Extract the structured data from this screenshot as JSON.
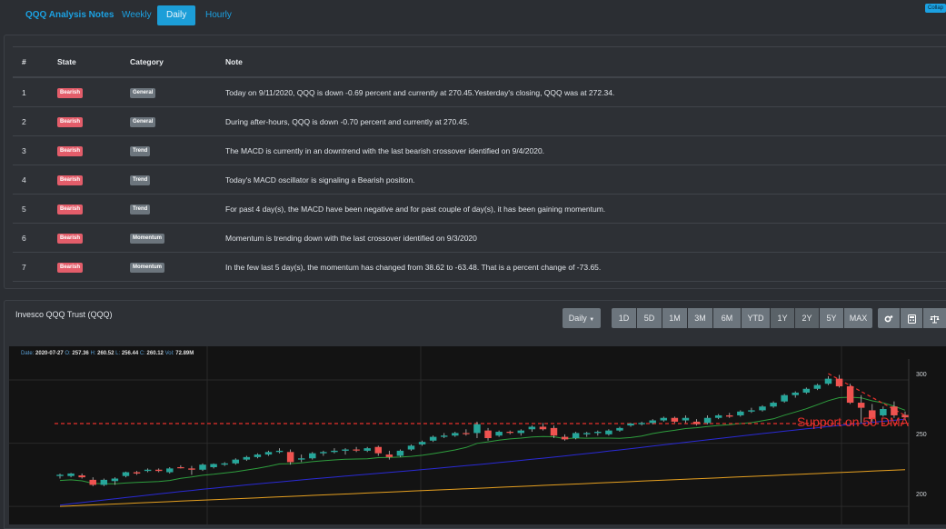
{
  "nav": {
    "brand": "QQQ Analysis Notes",
    "tabs": [
      "Weekly",
      "Daily",
      "Hourly"
    ],
    "collapse": "Collap"
  },
  "notes_table": {
    "headers": [
      "#",
      "State",
      "Category",
      "Note"
    ],
    "rows": [
      {
        "num": "1",
        "state": "Bearish",
        "category": "General",
        "note": "Today on 9/11/2020, QQQ is down -0.69 percent and currently at 270.45.Yesterday's closing, QQQ was at 272.34."
      },
      {
        "num": "2",
        "state": "Bearish",
        "category": "General",
        "note": "During after-hours, QQQ is down -0.70 percent and currently at 270.45."
      },
      {
        "num": "3",
        "state": "Bearish",
        "category": "Trend",
        "note": "The MACD is currently in an downtrend with the last bearish crossover identified on 9/4/2020."
      },
      {
        "num": "4",
        "state": "Bearish",
        "category": "Trend",
        "note": "Today's MACD oscillator is signaling a Bearish position."
      },
      {
        "num": "5",
        "state": "Bearish",
        "category": "Trend",
        "note": "For past 4 day(s), the MACD have been negative and for past couple of day(s), it has been gaining momentum."
      },
      {
        "num": "6",
        "state": "Bearish",
        "category": "Momentum",
        "note": "Momentum is trending down with the last crossover identified on 9/3/2020"
      },
      {
        "num": "7",
        "state": "Bearish",
        "category": "Momentum",
        "note": "In the few last 5 day(s), the momentum has changed from 38.62 to -63.48. That is a percent change of -73.65."
      }
    ]
  },
  "chart_panel": {
    "title": "Invesco QQQ Trust (QQQ)",
    "interval": "Daily",
    "ranges": [
      "1D",
      "5D",
      "1M",
      "3M",
      "6M",
      "YTD",
      "1Y",
      "2Y",
      "5Y",
      "MAX"
    ],
    "active_ranges": [
      "1Y",
      "2Y"
    ],
    "tool_icons": [
      "settings-icon",
      "calculator-icon",
      "scale-icon"
    ]
  },
  "readout": {
    "date_label": "Date:",
    "date": "2020-07-27",
    "o_label": "O:",
    "o": "257.36",
    "h_label": "H:",
    "h": "260.52",
    "l_label": "L:",
    "l": "256.44",
    "c_label": "C:",
    "c": "260.12",
    "vol_label": "Vol:",
    "vol": "72.89M"
  },
  "annotation": "Support on 50 DMA",
  "colors": {
    "accent": "#1ba1e2",
    "bearish": "#e35d6a",
    "up": "#26a69a",
    "down": "#ef5350",
    "ma_fast": "#2e9e3e",
    "ma_50": "#2a2ad6",
    "ma_200": "#e6a020",
    "support": "#e8302c"
  },
  "chart_data": {
    "type": "candlestick",
    "y_ticks": [
      200,
      250,
      300
    ],
    "ylim": [
      190,
      318
    ],
    "support_level": 265.5,
    "candles": [
      {
        "o": 224,
        "h": 226,
        "l": 222,
        "c": 225
      },
      {
        "o": 224,
        "h": 226.5,
        "l": 223,
        "c": 226
      },
      {
        "o": 224.5,
        "h": 226,
        "l": 222,
        "c": 223
      },
      {
        "o": 221,
        "h": 223,
        "l": 216,
        "c": 217
      },
      {
        "o": 217,
        "h": 222,
        "l": 216,
        "c": 221
      },
      {
        "o": 220,
        "h": 223,
        "l": 217,
        "c": 222
      },
      {
        "o": 224,
        "h": 227.5,
        "l": 223,
        "c": 227
      },
      {
        "o": 227,
        "h": 228,
        "l": 225,
        "c": 226
      },
      {
        "o": 228,
        "h": 230,
        "l": 227,
        "c": 229
      },
      {
        "o": 229,
        "h": 230,
        "l": 227,
        "c": 228
      },
      {
        "o": 227,
        "h": 231,
        "l": 226,
        "c": 230
      },
      {
        "o": 231,
        "h": 232.5,
        "l": 230,
        "c": 230.5
      },
      {
        "o": 230,
        "h": 232,
        "l": 225,
        "c": 229
      },
      {
        "o": 229,
        "h": 234,
        "l": 228,
        "c": 233
      },
      {
        "o": 231,
        "h": 234,
        "l": 230,
        "c": 233.5
      },
      {
        "o": 233,
        "h": 235,
        "l": 232,
        "c": 234
      },
      {
        "o": 234,
        "h": 238,
        "l": 233,
        "c": 237
      },
      {
        "o": 237,
        "h": 240,
        "l": 236,
        "c": 239
      },
      {
        "o": 239,
        "h": 242,
        "l": 238,
        "c": 241
      },
      {
        "o": 241,
        "h": 244,
        "l": 240,
        "c": 243
      },
      {
        "o": 243,
        "h": 246,
        "l": 242,
        "c": 244
      },
      {
        "o": 243,
        "h": 245,
        "l": 233,
        "c": 235
      },
      {
        "o": 237,
        "h": 241,
        "l": 235,
        "c": 238
      },
      {
        "o": 238,
        "h": 243,
        "l": 237,
        "c": 242
      },
      {
        "o": 242,
        "h": 244,
        "l": 240,
        "c": 243
      },
      {
        "o": 243,
        "h": 246,
        "l": 242,
        "c": 244
      },
      {
        "o": 244,
        "h": 246,
        "l": 241,
        "c": 245
      },
      {
        "o": 245,
        "h": 247,
        "l": 243,
        "c": 244.5
      },
      {
        "o": 244,
        "h": 247,
        "l": 243,
        "c": 246
      },
      {
        "o": 247,
        "h": 248,
        "l": 240,
        "c": 242
      },
      {
        "o": 241,
        "h": 244,
        "l": 237,
        "c": 239
      },
      {
        "o": 240,
        "h": 245,
        "l": 239,
        "c": 244
      },
      {
        "o": 245,
        "h": 249,
        "l": 244,
        "c": 248
      },
      {
        "o": 249,
        "h": 252,
        "l": 248,
        "c": 251
      },
      {
        "o": 252,
        "h": 256,
        "l": 251,
        "c": 255
      },
      {
        "o": 255,
        "h": 258,
        "l": 254,
        "c": 256
      },
      {
        "o": 256,
        "h": 259,
        "l": 255,
        "c": 258
      },
      {
        "o": 258,
        "h": 261,
        "l": 256,
        "c": 257.5
      },
      {
        "o": 258,
        "h": 267,
        "l": 254,
        "c": 265
      },
      {
        "o": 260,
        "h": 262,
        "l": 252,
        "c": 254
      },
      {
        "o": 256,
        "h": 260,
        "l": 255,
        "c": 259
      },
      {
        "o": 259,
        "h": 260,
        "l": 257,
        "c": 258.5
      },
      {
        "o": 258,
        "h": 261,
        "l": 256,
        "c": 260
      },
      {
        "o": 261,
        "h": 264,
        "l": 259,
        "c": 263
      },
      {
        "o": 263,
        "h": 266,
        "l": 260,
        "c": 261
      },
      {
        "o": 262,
        "h": 264,
        "l": 254,
        "c": 256
      },
      {
        "o": 255,
        "h": 257,
        "l": 252,
        "c": 253
      },
      {
        "o": 254,
        "h": 259,
        "l": 253,
        "c": 258
      },
      {
        "o": 257,
        "h": 259,
        "l": 255,
        "c": 258
      },
      {
        "o": 258,
        "h": 260,
        "l": 256,
        "c": 259
      },
      {
        "o": 257,
        "h": 261,
        "l": 256,
        "c": 260
      },
      {
        "o": 260,
        "h": 263,
        "l": 259,
        "c": 262
      },
      {
        "o": 264,
        "h": 266,
        "l": 263,
        "c": 265.5
      },
      {
        "o": 265,
        "h": 267,
        "l": 264,
        "c": 266
      },
      {
        "o": 266,
        "h": 269,
        "l": 265,
        "c": 268
      },
      {
        "o": 268,
        "h": 271,
        "l": 267,
        "c": 270
      },
      {
        "o": 270,
        "h": 271,
        "l": 266,
        "c": 267
      },
      {
        "o": 268,
        "h": 272,
        "l": 266,
        "c": 270
      },
      {
        "o": 267,
        "h": 269,
        "l": 264,
        "c": 265
      },
      {
        "o": 266,
        "h": 272,
        "l": 265,
        "c": 270
      },
      {
        "o": 270,
        "h": 273,
        "l": 269,
        "c": 272
      },
      {
        "o": 272,
        "h": 274,
        "l": 270,
        "c": 271
      },
      {
        "o": 272,
        "h": 276,
        "l": 271,
        "c": 275
      },
      {
        "o": 275,
        "h": 278,
        "l": 274,
        "c": 276
      },
      {
        "o": 276,
        "h": 280,
        "l": 275,
        "c": 279
      },
      {
        "o": 279,
        "h": 283,
        "l": 278,
        "c": 282
      },
      {
        "o": 283,
        "h": 289,
        "l": 282,
        "c": 288
      },
      {
        "o": 288,
        "h": 291,
        "l": 286,
        "c": 290
      },
      {
        "o": 290,
        "h": 294,
        "l": 289,
        "c": 293
      },
      {
        "o": 293,
        "h": 297,
        "l": 292,
        "c": 296
      },
      {
        "o": 297,
        "h": 303,
        "l": 296,
        "c": 301
      },
      {
        "o": 301,
        "h": 304,
        "l": 294,
        "c": 295
      },
      {
        "o": 295,
        "h": 297,
        "l": 281,
        "c": 282
      },
      {
        "o": 282,
        "h": 288,
        "l": 266,
        "c": 278
      },
      {
        "o": 276,
        "h": 281,
        "l": 267,
        "c": 269
      },
      {
        "o": 272,
        "h": 279,
        "l": 271,
        "c": 277
      },
      {
        "o": 279,
        "h": 283,
        "l": 270,
        "c": 272
      },
      {
        "o": 272.3,
        "h": 275,
        "l": 268,
        "c": 270.45
      }
    ]
  }
}
